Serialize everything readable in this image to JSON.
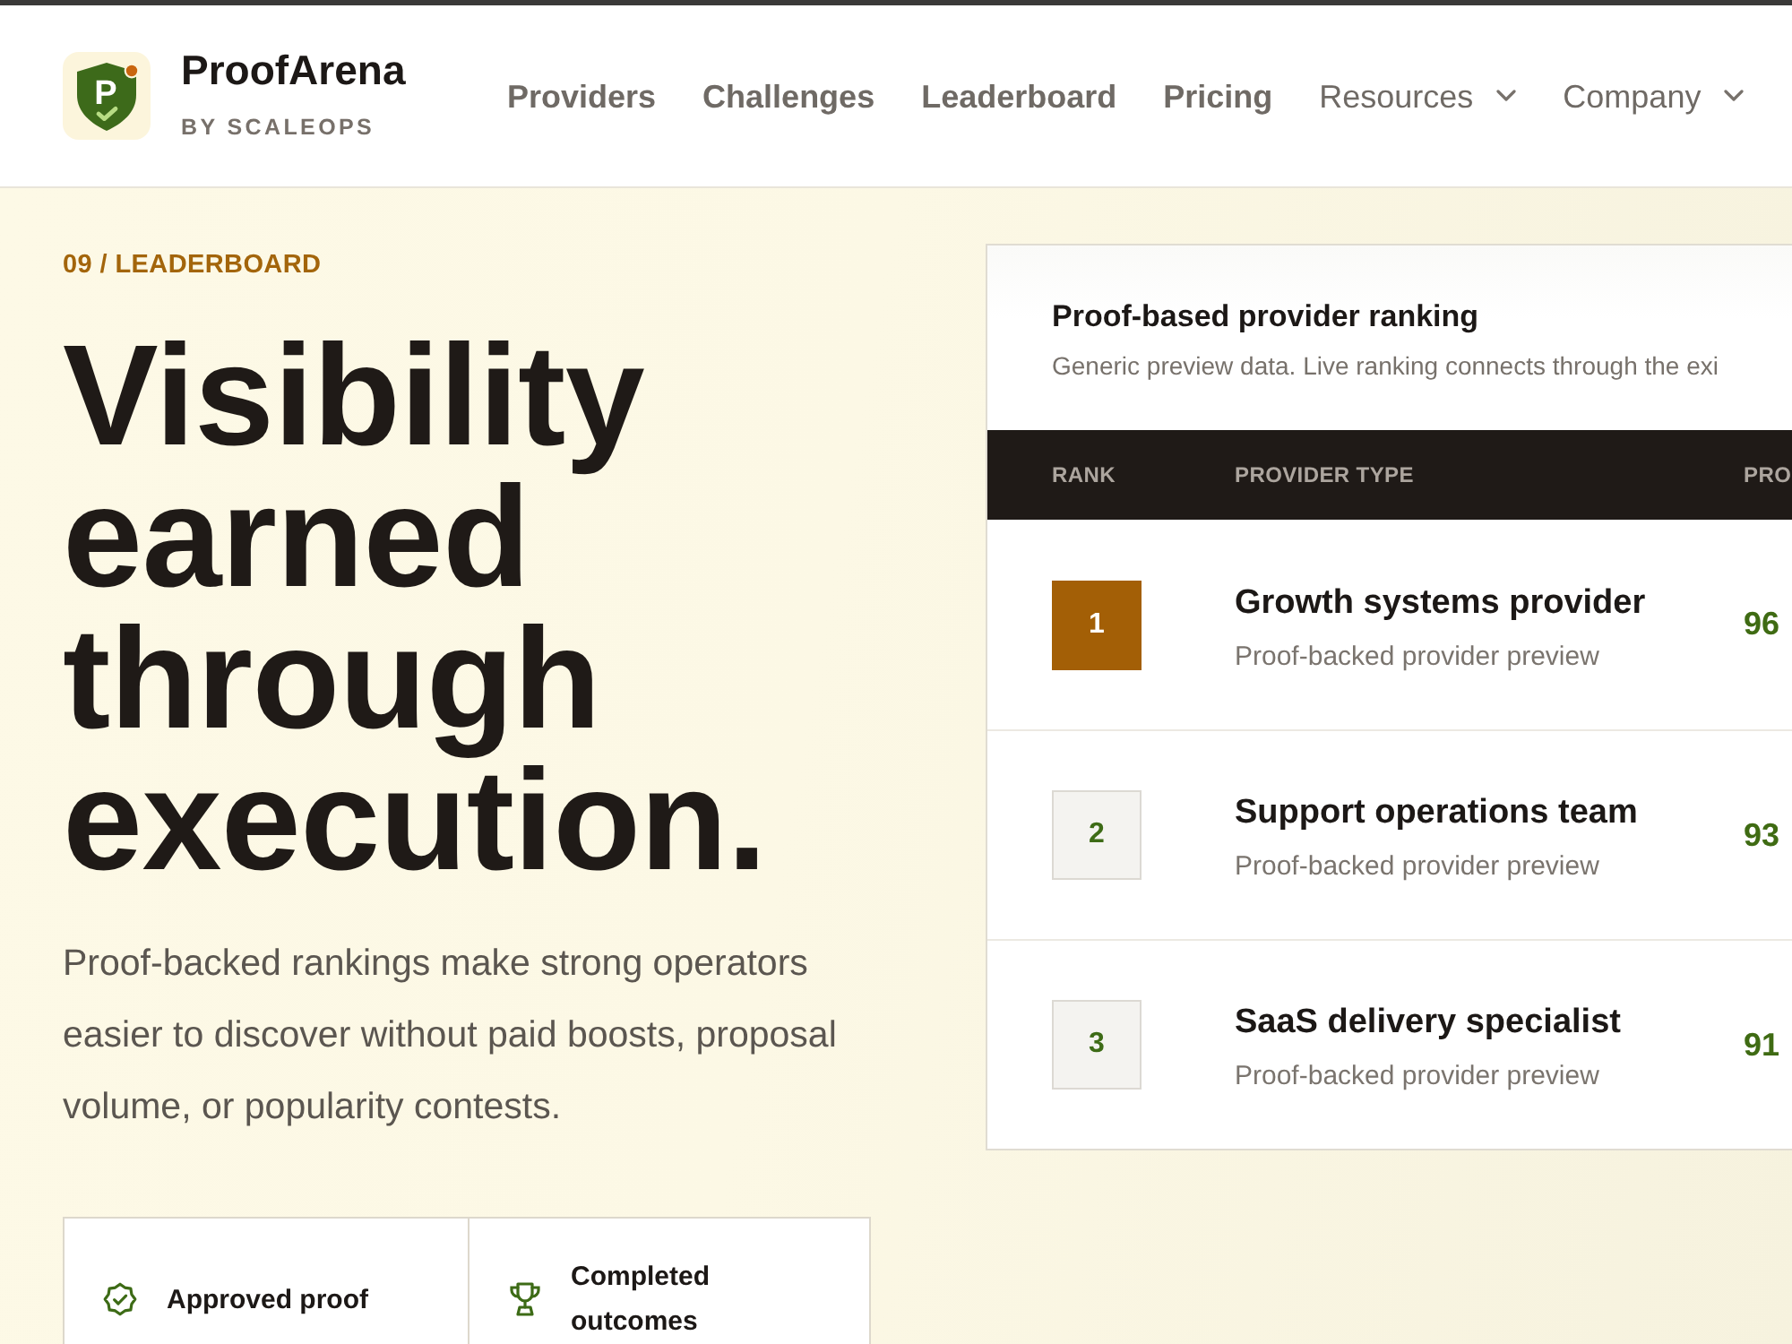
{
  "top_nav": {
    "logo": {
      "mark": "P",
      "name": "ProofArena",
      "tagline": "BY SCALEOPS"
    },
    "links": [
      {
        "label": "Providers",
        "kind": "link"
      },
      {
        "label": "Challenges",
        "kind": "link"
      },
      {
        "label": "Leaderboard",
        "kind": "link"
      },
      {
        "label": "Pricing",
        "kind": "link"
      },
      {
        "label": "Resources",
        "kind": "dropdown"
      },
      {
        "label": "Company",
        "kind": "dropdown"
      }
    ]
  },
  "hero": {
    "eyebrow": "09 / LEADERBOARD",
    "headline": "Visibility earned through execution.",
    "intro": "Proof-backed rankings make strong operators easier to discover without paid boosts, proposal volume, or popularity contests.",
    "highlights": [
      {
        "label": "Approved proof"
      },
      {
        "label": "Completed outcomes"
      }
    ]
  },
  "ranking_card": {
    "title": "Proof-based provider ranking",
    "subtitle": "Generic preview data. Live ranking connects through the exi",
    "columns": [
      "RANK",
      "PROVIDER TYPE",
      "PRO"
    ],
    "rows": [
      {
        "rank": "1",
        "highlighted": true,
        "name": "Growth systems provider",
        "description": "Proof-backed provider preview",
        "column_3": "96"
      },
      {
        "rank": "2",
        "highlighted": false,
        "name": "Support operations team",
        "description": "Proof-backed provider preview",
        "column_3": "93"
      },
      {
        "rank": "3",
        "highlighted": false,
        "name": "SaaS delivery specialist",
        "description": "Proof-backed provider preview",
        "column_3": "91"
      }
    ]
  }
}
